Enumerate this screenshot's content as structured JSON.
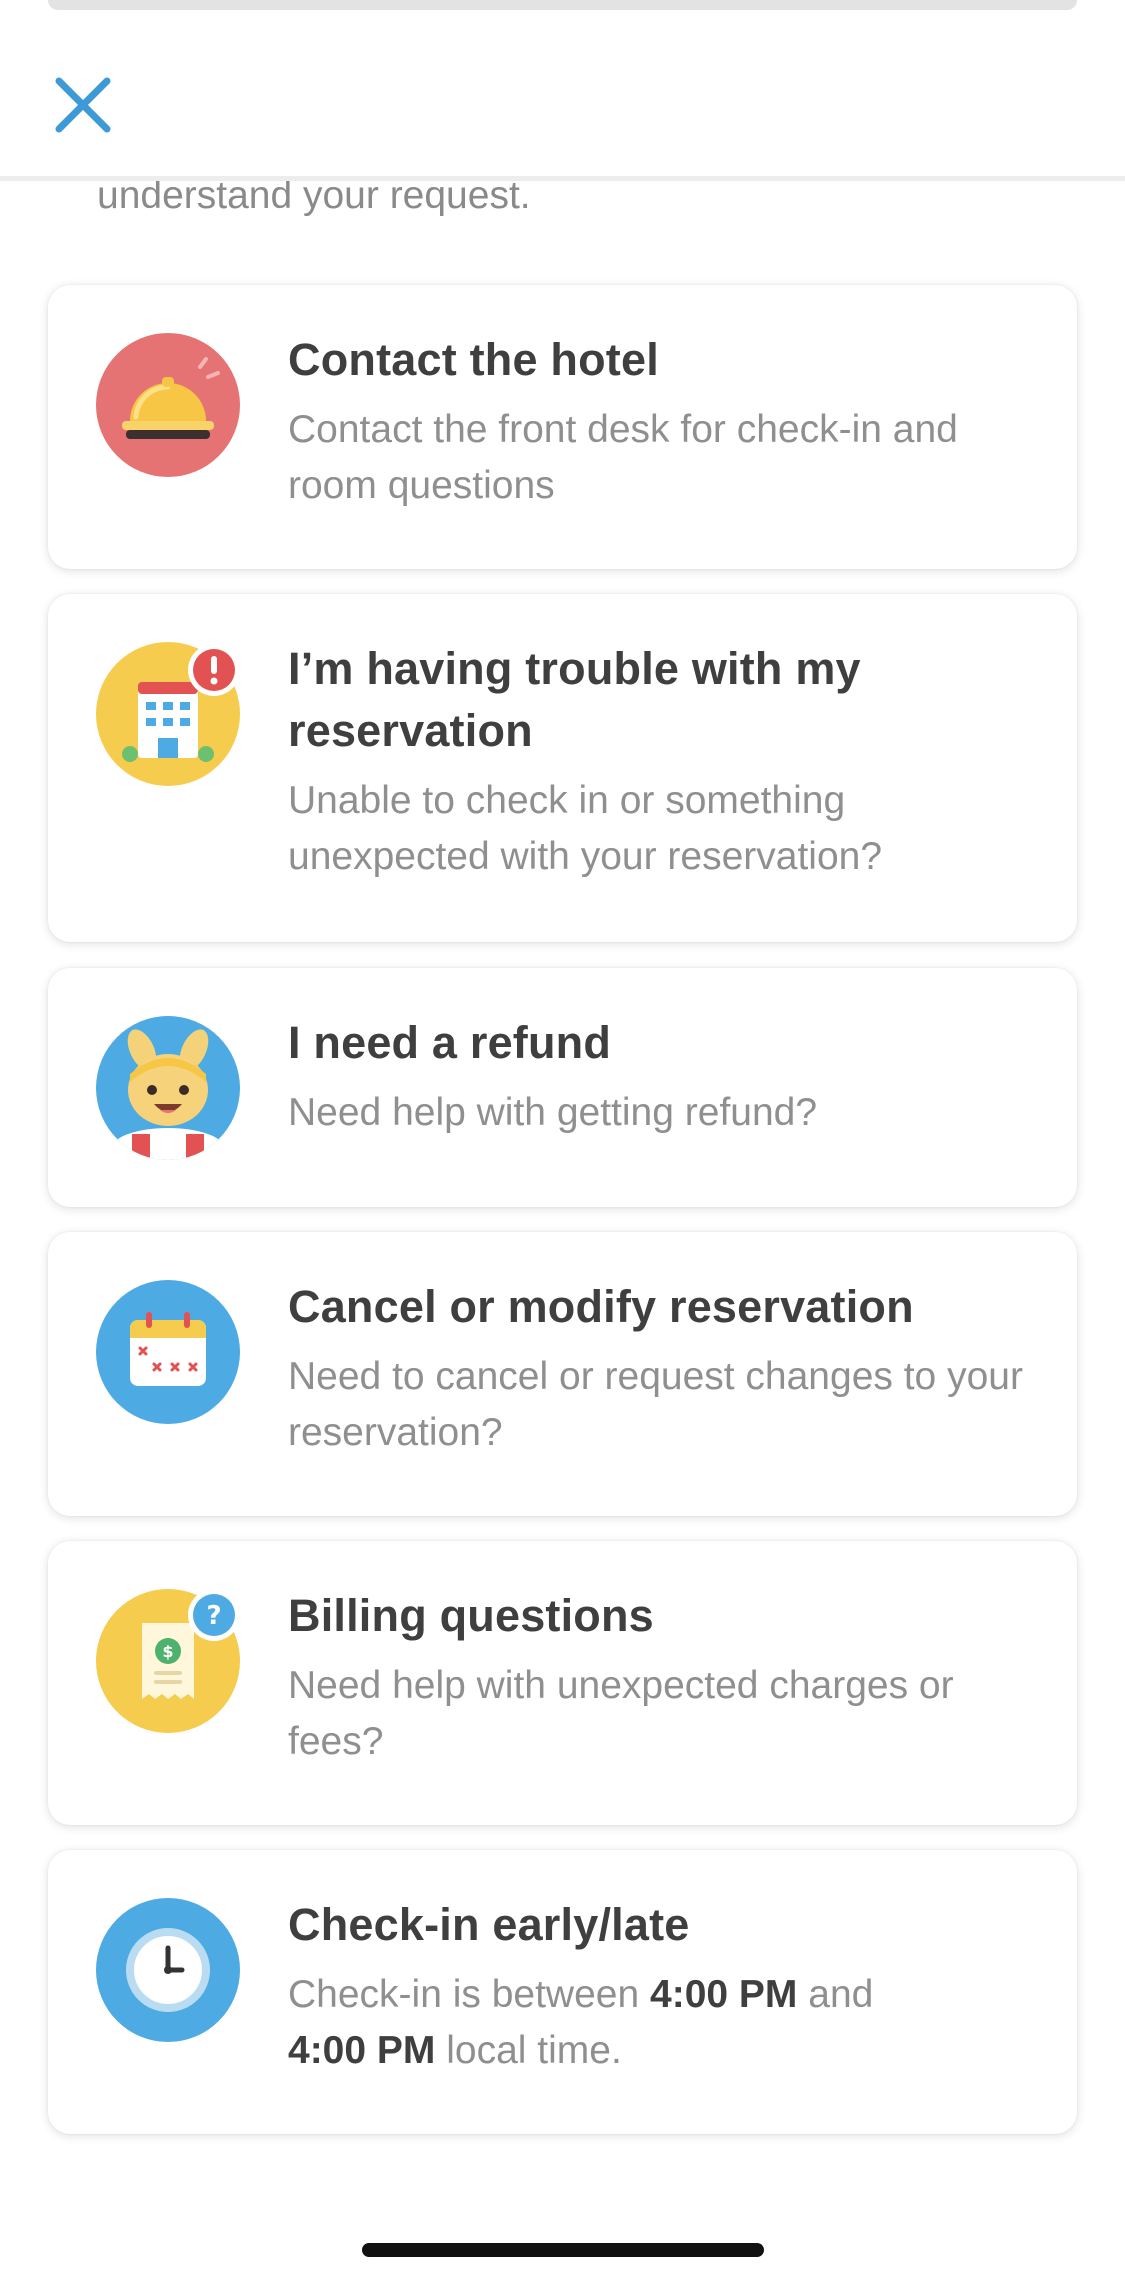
{
  "header": {
    "close_icon": "close-icon"
  },
  "intro_text": "understand your request.",
  "colors": {
    "accent": "#3d9ad6",
    "hotel_bg": "#e57373",
    "yellow_bg": "#f6cc4e",
    "blue_bg": "#4eaae3",
    "alert_red": "#e35252",
    "title": "#3f3f3f",
    "desc": "#8f8f8f"
  },
  "options": [
    {
      "id": "contact-hotel",
      "icon": "service-bell-icon",
      "title": "Contact the hotel",
      "desc": "Contact the front desk for check-in and room questions"
    },
    {
      "id": "reservation-trouble",
      "icon": "hotel-alert-icon",
      "title": "I’m having trouble with my reservation",
      "desc": "Unable to check in or something unexpected with your reservation?"
    },
    {
      "id": "refund",
      "icon": "mascot-lifebuoy-icon",
      "title": "I need a refund",
      "desc": "Need help with getting refund?"
    },
    {
      "id": "cancel-modify",
      "icon": "calendar-icon",
      "title": "Cancel or modify reservation",
      "desc": "Need to cancel or request changes to your reservation?"
    },
    {
      "id": "billing",
      "icon": "receipt-question-icon",
      "title": "Billing questions",
      "desc": "Need help with unexpected charges or fees?"
    },
    {
      "id": "checkin-time",
      "icon": "clock-icon",
      "title": "Check-in early/late",
      "desc_prefix": "Check-in is between ",
      "desc_time1": "4:00 PM",
      "desc_mid": " and",
      "desc_time2": "4:00 PM",
      "desc_suffix": " local time."
    }
  ]
}
